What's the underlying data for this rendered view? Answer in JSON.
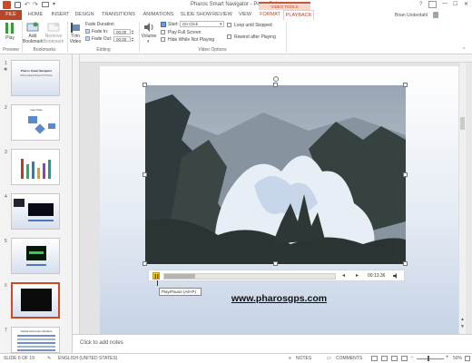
{
  "window": {
    "title": "Pharos Smart Navigator - PowerPoint",
    "help": "?",
    "minimize": "—",
    "maximize": "☐",
    "close": "✕"
  },
  "tabs": {
    "file": "FILE",
    "items": [
      "HOME",
      "INSERT",
      "DESIGN",
      "TRANSITIONS",
      "ANIMATIONS",
      "SLIDE SHOW",
      "REVIEW",
      "VIEW",
      "FORMAT",
      "PLAYBACK"
    ],
    "context_label": "VIDEO TOOLS",
    "active": "PLAYBACK",
    "user": "Brian Underdahl"
  },
  "ribbon": {
    "play_label": "Play",
    "preview_group": "Preview",
    "add_bookmark": "Add Bookmark",
    "remove_bookmark": "Remove Bookmark",
    "bookmarks_group": "Bookmarks",
    "trim_video": "Trim Video",
    "fade_duration": "Fade Duration",
    "fade_in_label": "Fade In:",
    "fade_in_value": "00.00",
    "fade_out_label": "Fade Out:",
    "fade_out_value": "00.00",
    "editing_group": "Editing",
    "volume": "Volume",
    "start_label": "Start:",
    "start_value": "On Click",
    "play_full_screen": "Play Full Screen",
    "hide_while_not_playing": "Hide While Not Playing",
    "loop_until_stopped": "Loop until Stopped",
    "rewind_after_playing": "Rewind after Playing",
    "video_options_group": "Video Options"
  },
  "slides_panel": {
    "numbers": [
      "1",
      "2",
      "3",
      "4",
      "5",
      "6",
      "7"
    ],
    "selected": "6",
    "thumb1_title": "Pharos Smart Navigator",
    "thumb1_sub": "GPS-enabled Pocket PC Phone",
    "thumb2_title": "User Files",
    "thumb7_title": "Global Ascension Markets"
  },
  "video_controls": {
    "play_icon": "play-pause-icon",
    "time": "00:13.36",
    "tooltip": "Play/Pause (Alt+P)",
    "progress": 0.18
  },
  "slide": {
    "url": "www.pharosgps.com"
  },
  "notes": {
    "placeholder": "Click to add notes"
  },
  "status": {
    "slide_info": "SLIDE 6 OF 19",
    "language": "ENGLISH (UNITED STATES)",
    "notes": "NOTES",
    "comments": "COMMENTS",
    "zoom": "50%"
  },
  "colors": {
    "file_tab": "#b7472a",
    "accent": "#d24726",
    "context_tab": "#c55a3a"
  }
}
